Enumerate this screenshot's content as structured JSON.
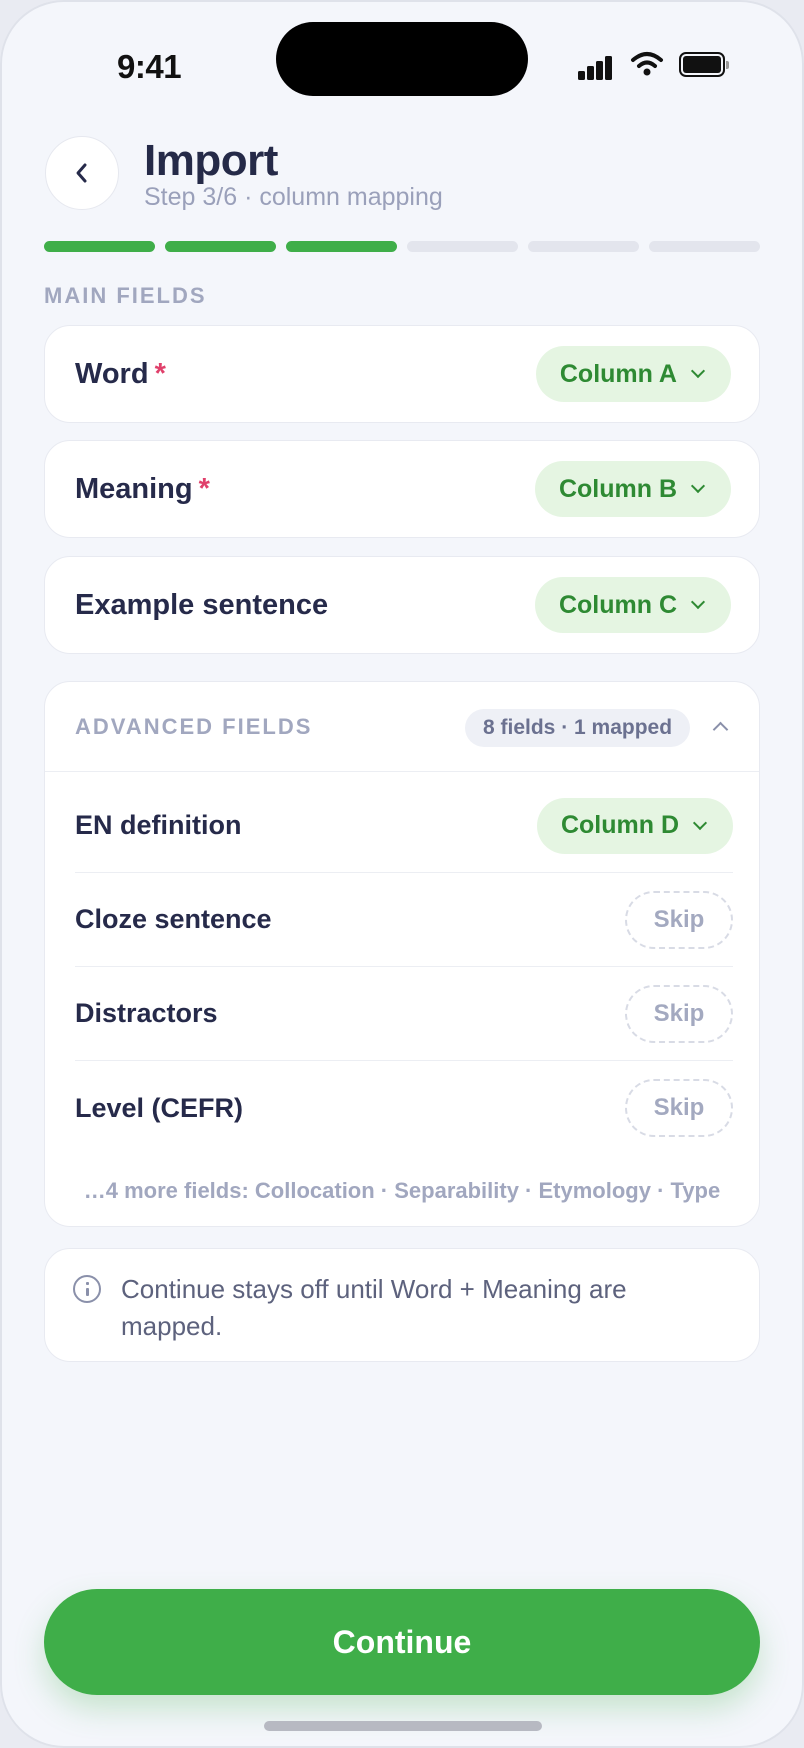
{
  "status_bar": {
    "time": "9:41"
  },
  "header": {
    "title": "Import",
    "subtitle": "Step 3/6 · column mapping"
  },
  "progress": {
    "total_steps": 6,
    "completed_steps": 3
  },
  "main_section": {
    "label": "MAIN FIELDS",
    "fields": [
      {
        "label": "Word",
        "required_mark": "*",
        "column": "Column A"
      },
      {
        "label": "Meaning",
        "required_mark": "*",
        "column": "Column B"
      },
      {
        "label": "Example sentence",
        "column": "Column C"
      }
    ]
  },
  "advanced_section": {
    "label": "ADVANCED FIELDS",
    "count_badge": "8 fields · 1 mapped",
    "fields": [
      {
        "label": "EN definition",
        "column": "Column D"
      },
      {
        "label": "Cloze sentence",
        "action": "Skip"
      },
      {
        "label": "Distractors",
        "action": "Skip"
      },
      {
        "label": "Level (CEFR)",
        "action": "Skip"
      }
    ],
    "more_text": "…4 more fields: Collocation · Separability · Etymology · Type"
  },
  "info": {
    "text": "Continue stays off until Word + Meaning are mapped."
  },
  "continue_button": {
    "label": "Continue"
  },
  "colors": {
    "accent": "#3fae49",
    "required": "#e0406b",
    "pill_bg": "#e5f5e2",
    "pill_text": "#2e8a33"
  }
}
